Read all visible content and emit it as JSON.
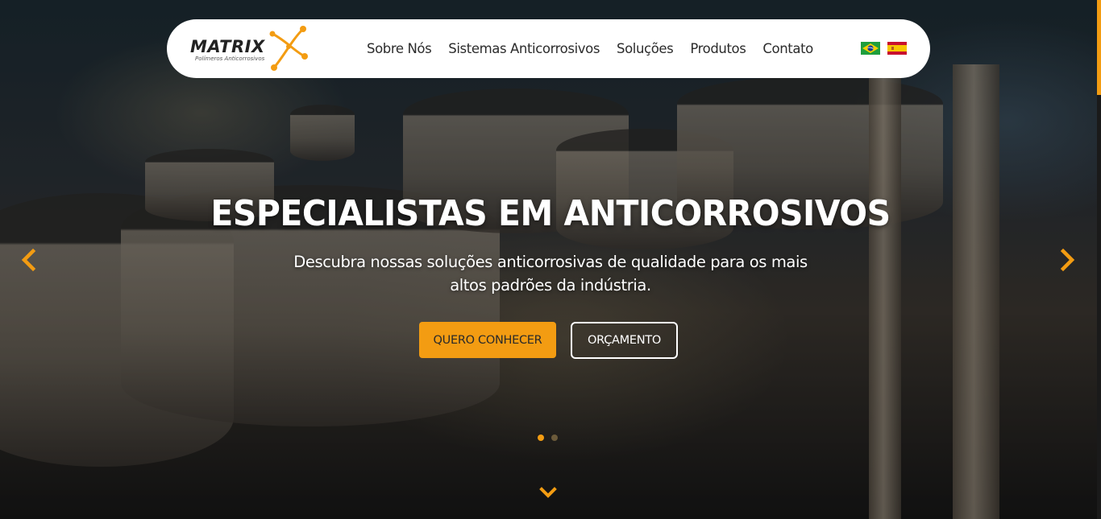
{
  "brand": {
    "name": "MATRIX",
    "tagline": "Polímeros Anticorrosivos"
  },
  "nav": {
    "items": [
      {
        "label": "Sobre Nós"
      },
      {
        "label": "Sistemas Anticorrosivos"
      },
      {
        "label": "Soluções"
      },
      {
        "label": "Produtos"
      },
      {
        "label": "Contato"
      }
    ],
    "languages": [
      {
        "icon": "brazil-flag-icon"
      },
      {
        "icon": "spain-flag-icon"
      }
    ]
  },
  "hero": {
    "title": "ESPECIALISTAS EM ANTICORROSIVOS",
    "subtitle": "Descubra nossas soluções anticorrosivas de qualidade para os mais altos padrões da indústria.",
    "primary_button": "QUERO CONHECER",
    "secondary_button": "ORÇAMENTO",
    "slides_total": 2,
    "active_slide": 1
  },
  "colors": {
    "accent": "#f39c12",
    "navbar_bg": "#ffffff",
    "text_light": "#ffffff",
    "text_dark": "#2c2c2c"
  },
  "icons": {
    "prev": "chevron-left-icon",
    "next": "chevron-right-icon",
    "scroll_down": "chevron-down-icon"
  }
}
